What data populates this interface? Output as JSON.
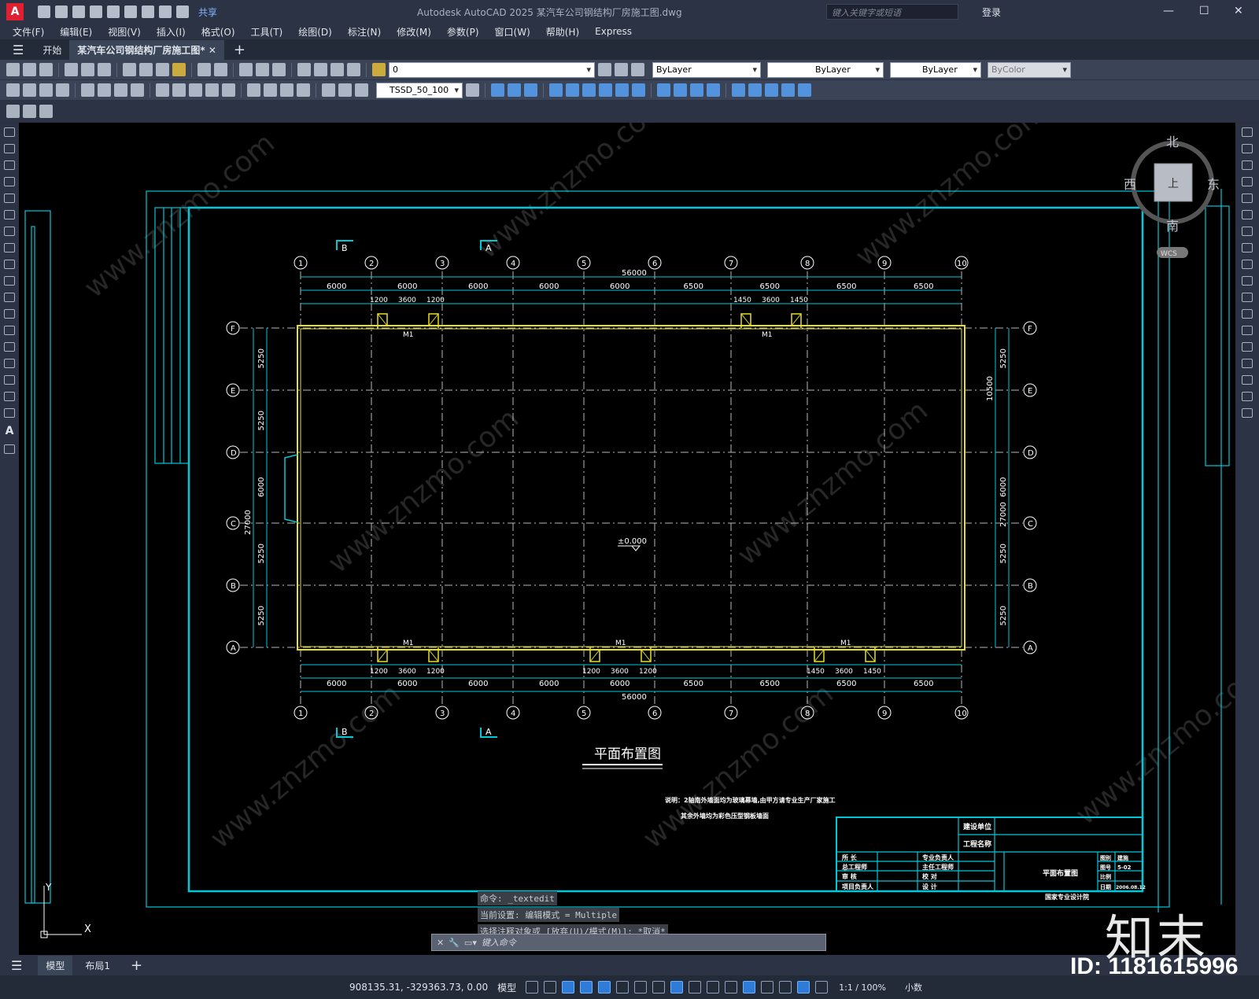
{
  "titlebar": {
    "app": "A",
    "share": "共享",
    "title": "Autodesk AutoCAD 2025    某汽车公司钢结构厂房施工图.dwg",
    "search_placeholder": "键入关键字或短语",
    "login": "登录",
    "minimize": "—",
    "maximize": "☐",
    "close": "✕"
  },
  "menu": [
    "文件(F)",
    "编辑(E)",
    "视图(V)",
    "插入(I)",
    "格式(O)",
    "工具(T)",
    "绘图(D)",
    "标注(N)",
    "修改(M)",
    "参数(P)",
    "窗口(W)",
    "帮助(H)",
    "Express"
  ],
  "tabs": {
    "start": "开始",
    "doc": "某汽车公司钢结构厂房施工图*"
  },
  "toolbar": {
    "layer": "0",
    "color": "ByLayer",
    "linetype": "ByLayer",
    "lineweight": "ByLayer",
    "plotstyle": "ByColor",
    "dimstyle": "TSSD_50_100"
  },
  "viewcube": {
    "north": "北",
    "south": "南",
    "east": "东",
    "west": "西",
    "top": "上",
    "wcs": "WCS"
  },
  "drawing": {
    "title": "平面布置图",
    "elevation": "±0.000",
    "note1": "说明：2轴南外墙面均为玻璃幕墙,由甲方请专业生产厂家施工",
    "note2": "其余外墙均为彩色压型钢板墙面",
    "cols": [
      "1",
      "2",
      "3",
      "4",
      "5",
      "6",
      "7",
      "8",
      "9",
      "10"
    ],
    "rows": [
      "F",
      "E",
      "D",
      "C",
      "B",
      "A"
    ],
    "spans_top": [
      "6000",
      "6000",
      "6000",
      "6000",
      "6000",
      "6500",
      "6500",
      "6500",
      "6500"
    ],
    "spans_bottom": [
      "6000",
      "6000",
      "6000",
      "6000",
      "6000",
      "6500",
      "6500",
      "6500",
      "6500"
    ],
    "total_x": "56000",
    "total_y": "27000",
    "row_spans": [
      "5250",
      "5250",
      "6000",
      "5250",
      "5250"
    ],
    "right_inner": "10500",
    "door": "M1",
    "door_top_left": [
      "1200",
      "3600",
      "1200"
    ],
    "door_top_right": [
      "1450",
      "3600",
      "1450"
    ],
    "door_bot_1": [
      "1200",
      "3600",
      "1200"
    ],
    "door_bot_2": [
      "1200",
      "3600",
      "1200"
    ],
    "door_bot_3": [
      "1450",
      "3600",
      "1450"
    ],
    "section_a": "A",
    "section_b": "B",
    "tb_build": "建设单位",
    "tb_project": "工程名称",
    "tb_drawing": "平面布置图",
    "tb_rows_left": [
      "所 长",
      "总工程师",
      "审 核",
      "项目负责人"
    ],
    "tb_rows_mid": [
      "专业负责人",
      "主任工程师",
      "校 对",
      "设 计"
    ],
    "tb_right": [
      "图别",
      "图号",
      "比例",
      "日期"
    ],
    "tb_right_val": [
      "建施",
      "5-02",
      "",
      "2006.08.12"
    ],
    "tb_bottom": "国家专业设计院"
  },
  "command": {
    "line1": "命令: _textedit",
    "line2": "当前设置: 编辑模式 = Multiple",
    "line3": "选择注释对象或 [放弃(U)/模式(M)]: *取消*",
    "input_placeholder": "键入命令"
  },
  "layout": {
    "model": "模型",
    "layout1": "布局1",
    "add": "+"
  },
  "status": {
    "coords": "908135.31, -329363.73, 0.00",
    "mode": "模型",
    "scale": "1:1 / 100%",
    "units": "小数"
  },
  "watermark": {
    "logo": "知末",
    "id": "ID: 1181615996",
    "text": "www.znzmo.com"
  }
}
